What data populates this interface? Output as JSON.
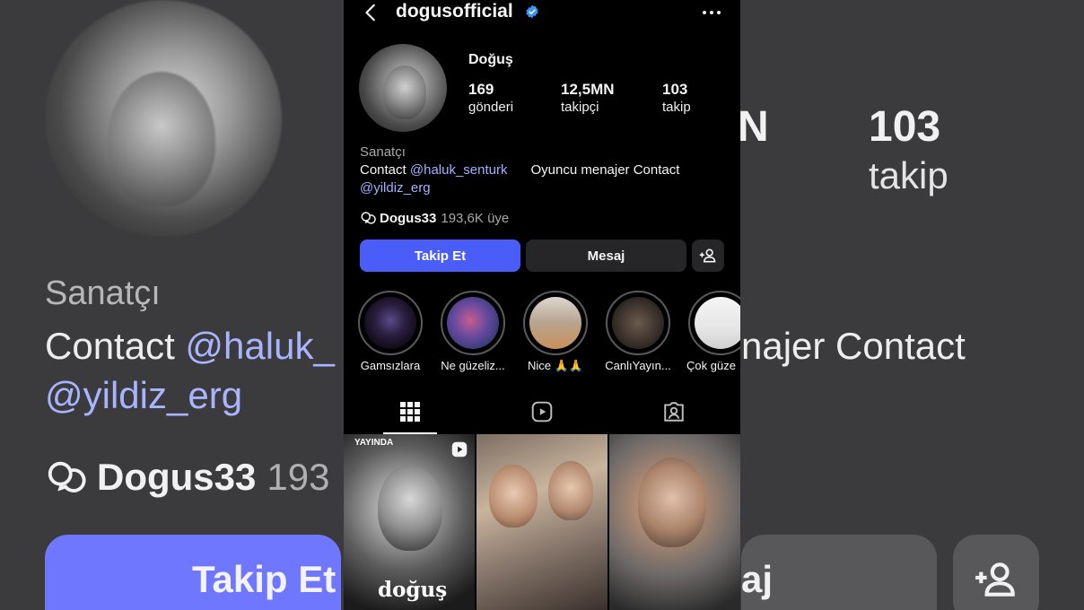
{
  "header": {
    "username": "dogusofficial"
  },
  "profile": {
    "full_name": "Doğuş",
    "stats": [
      {
        "value": "169",
        "label": "gönderi"
      },
      {
        "value": "12,5MN",
        "label": "takipçi"
      },
      {
        "value": "103",
        "label": "takip"
      }
    ],
    "bio": {
      "category": "Sanatçı",
      "line1_prefix": "Contact ",
      "line1_mention": "@haluk_senturk",
      "line1_suffix": "Oyuncu menajer Contact",
      "line2_mention": "@yildiz_erg"
    },
    "channel": {
      "name": "Dogus33",
      "members": "193,6K üye"
    }
  },
  "actions": {
    "follow_label": "Takip Et",
    "message_label": "Mesaj"
  },
  "highlights": [
    {
      "label": "Gamsızlara"
    },
    {
      "label": "Ne güzeliz..."
    },
    {
      "label": "Nice 🙏🙏"
    },
    {
      "label": "CanlıYayın..."
    },
    {
      "label": "Çok güze"
    }
  ],
  "grid": {
    "tile1_badge": "YAYINDA",
    "tile1_caption": "doğuş"
  },
  "background": {
    "category": "Sanatçı",
    "contact_prefix": "Contact ",
    "contact_mention": "@haluk_",
    "mention2": "@yildiz_erg",
    "channel_name": "Dogus33",
    "channel_members": "193",
    "follow_label": "Takip Et",
    "stat_value_partial": "N",
    "following_value": "103",
    "following_label": "takip",
    "menajer_text": "najer Contact",
    "message_partial": "aj"
  },
  "colors": {
    "follow_button": "#4a5df9",
    "mention": "#a4b0ff",
    "verified": "#3897f0"
  }
}
